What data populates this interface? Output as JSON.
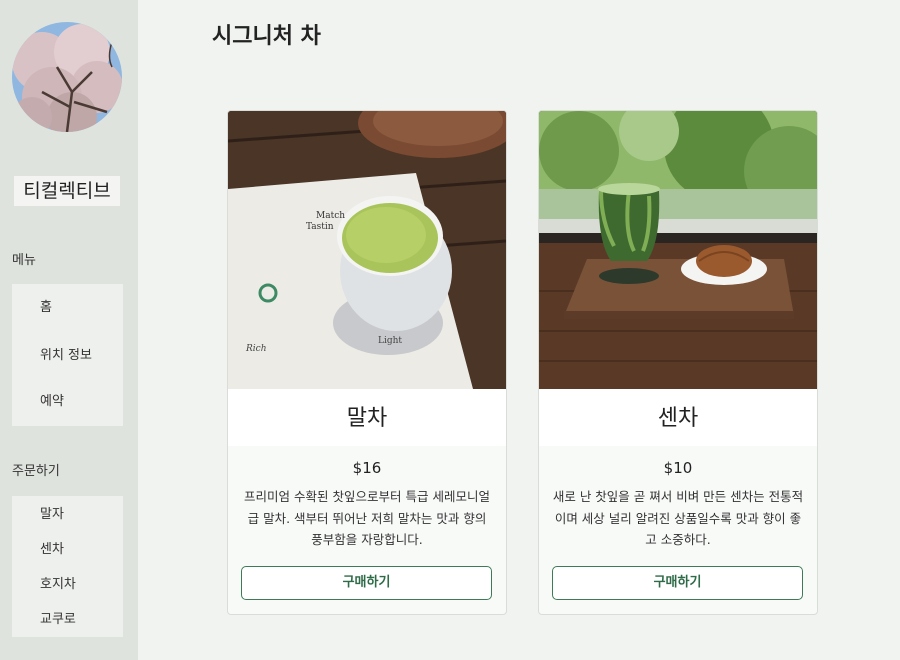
{
  "brand": {
    "name": "티컬렉티브"
  },
  "sidebar": {
    "menu_label": "메뉴",
    "menu_items": [
      {
        "label": "홈"
      },
      {
        "label": "위치 정보"
      },
      {
        "label": "예약"
      }
    ],
    "order_label": "주문하기",
    "order_items": [
      {
        "label": "말자"
      },
      {
        "label": "센차"
      },
      {
        "label": "호지차"
      },
      {
        "label": "교쿠로"
      }
    ]
  },
  "main": {
    "title": "시그니처 차",
    "products": [
      {
        "name": "말차",
        "price": "$16",
        "description": "프리미엄 수확된 찻잎으로부터 특급 세레모니얼급 말차. 색부터 뛰어난 저희 말차는 맛과 향의 풍부함을 자랑합니다.",
        "button": "구매하기",
        "photo_text": {
          "line1": "Match",
          "line2": "Tastin",
          "left": "Rich",
          "right": "Light"
        }
      },
      {
        "name": "센차",
        "price": "$10",
        "description": "새로 난 찻잎을 곧 쪄서 비벼 만든 센차는 전통적이며 세상 널리 알려진 상품일수록 맛과 향이 좋고 소중하다.",
        "button": "구매하기"
      }
    ]
  },
  "colors": {
    "sidebar": "#dfe3de",
    "page": "#f1f3f0",
    "accent": "#3f7a58"
  }
}
